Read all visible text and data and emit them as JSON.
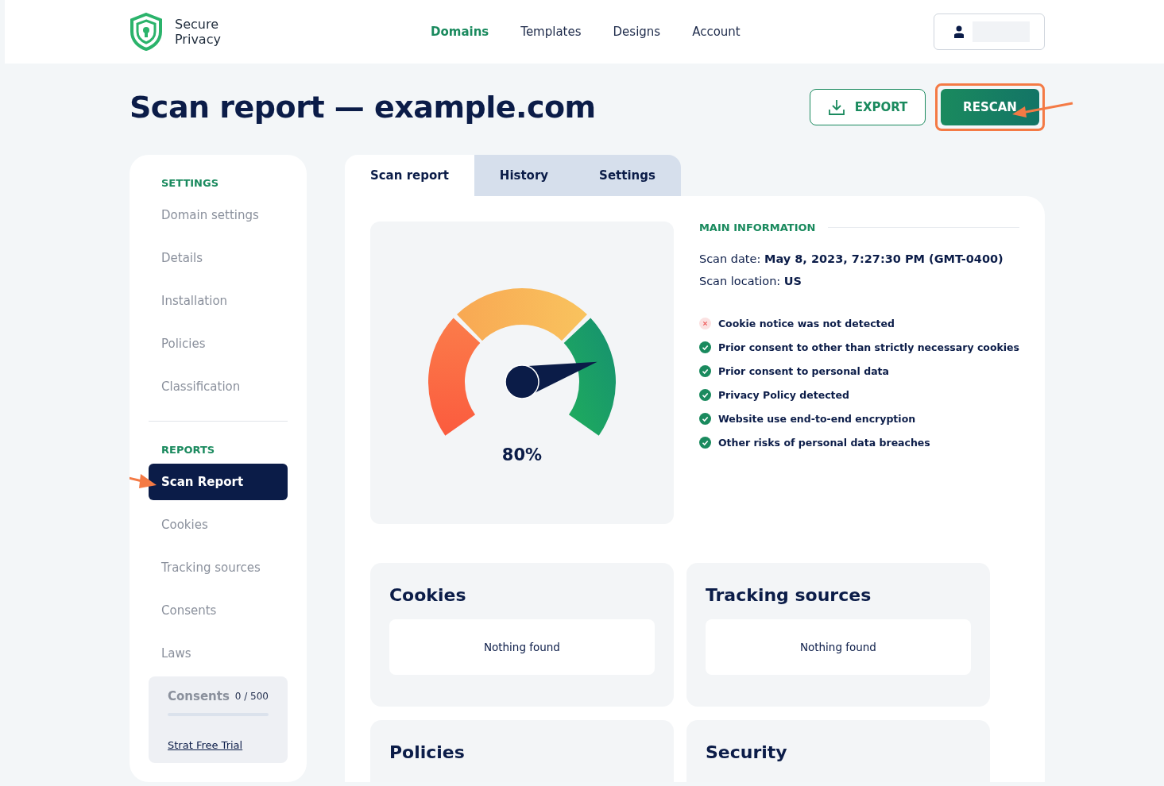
{
  "brand": {
    "line_1": "Secure",
    "line_2": "Privacy"
  },
  "nav": [
    {
      "label": "Domains",
      "selected": true
    },
    {
      "label": "Templates",
      "selected": false
    },
    {
      "label": "Designs",
      "selected": false
    },
    {
      "label": "Account",
      "selected": false
    }
  ],
  "title": "Scan report — example.com",
  "actions": {
    "export": "EXPORT",
    "rescan": "RESCAN",
    "rescan_highlighted": true
  },
  "sidebar": {
    "sections": [
      {
        "heading": "SETTINGS",
        "items": [
          {
            "label": "Domain settings",
            "selected": false
          },
          {
            "label": "Details",
            "selected": false
          },
          {
            "label": "Installation",
            "selected": false
          },
          {
            "label": "Policies",
            "selected": false
          },
          {
            "label": "Classification",
            "selected": false
          }
        ]
      },
      {
        "heading": "REPORTS",
        "items": [
          {
            "label": "Scan Report",
            "selected": true
          },
          {
            "label": "Cookies",
            "selected": false
          },
          {
            "label": "Tracking sources",
            "selected": false
          },
          {
            "label": "Consents",
            "selected": false
          },
          {
            "label": "Laws",
            "selected": false
          }
        ]
      }
    ],
    "quota": {
      "label": "Consents",
      "count": "0 / 500",
      "level": 0,
      "link": "Strat Free Trial"
    }
  },
  "tabs": [
    {
      "label": "Scan report",
      "selected": true
    },
    {
      "label": "History",
      "selected": false
    },
    {
      "label": "Settings",
      "selected": false
    }
  ],
  "gauge": {
    "level": 0.8,
    "reading": "80%"
  },
  "main_information": {
    "heading": "MAIN INFORMATION",
    "facts": [
      {
        "label": "Scan date:",
        "value": "May 8, 2023, 7:27:30 PM (GMT-0400)"
      },
      {
        "label": "Scan location:",
        "value": "US"
      }
    ],
    "checks": [
      {
        "text": "Cookie notice was not detected",
        "passed": false
      },
      {
        "text": "Prior consent to other than strictly necessary cookies",
        "passed": true
      },
      {
        "text": "Prior consent to personal data",
        "passed": true
      },
      {
        "text": "Privacy Policy detected",
        "passed": true
      },
      {
        "text": "Website use end-to-end encryption",
        "passed": true
      },
      {
        "text": "Other risks of personal data breaches",
        "passed": true
      }
    ]
  },
  "cards": [
    {
      "title": "Cookies",
      "message": "Nothing found"
    },
    {
      "title": "Tracking sources",
      "message": "Nothing found"
    },
    {
      "title": "Policies"
    },
    {
      "title": "Security"
    }
  ]
}
